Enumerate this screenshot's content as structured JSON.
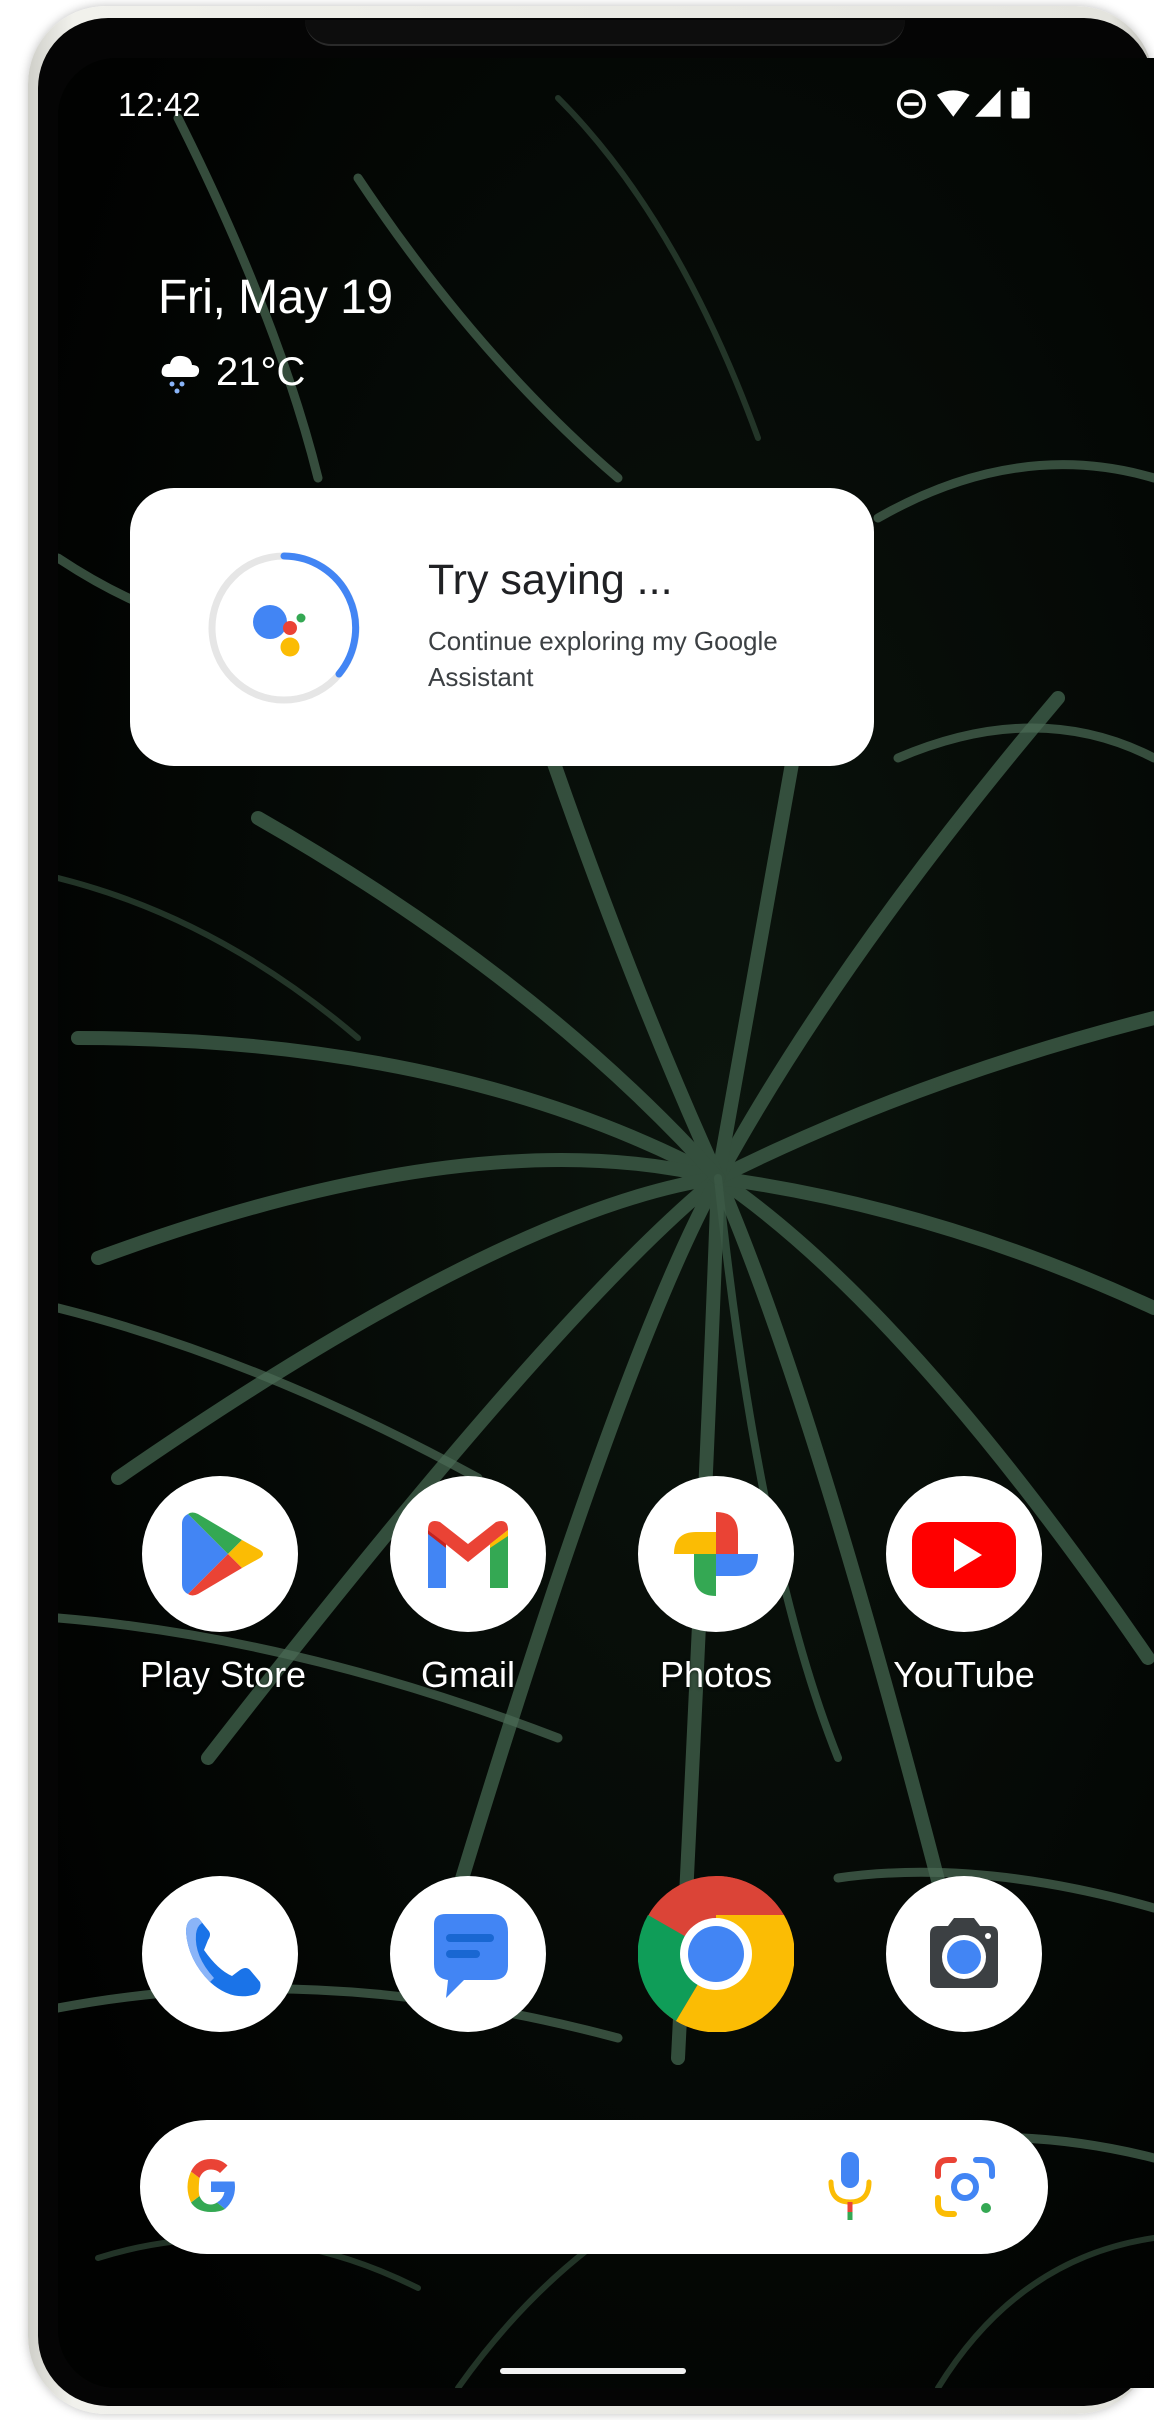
{
  "status_bar": {
    "time": "12:42",
    "icons": [
      "do-not-disturb-icon",
      "wifi-icon",
      "cellular-signal-icon",
      "battery-icon"
    ]
  },
  "at_a_glance": {
    "date": "Fri, May 19",
    "weather_icon": "rain-cloud-icon",
    "temperature": "21°C"
  },
  "assistant_card": {
    "title": "Try saying ...",
    "subtitle": "Continue exploring my Google Assistant",
    "icon": "google-assistant-icon",
    "progress": 0.35
  },
  "home_apps": [
    {
      "label": "Play Store",
      "icon": "play-store-icon"
    },
    {
      "label": "Gmail",
      "icon": "gmail-icon"
    },
    {
      "label": "Photos",
      "icon": "photos-icon"
    },
    {
      "label": "YouTube",
      "icon": "youtube-icon"
    }
  ],
  "dock_apps": [
    {
      "icon": "phone-icon"
    },
    {
      "icon": "messages-icon"
    },
    {
      "icon": "chrome-icon"
    },
    {
      "icon": "camera-icon"
    }
  ],
  "search_bar": {
    "icons": [
      "google-g-icon",
      "microphone-icon",
      "google-lens-icon"
    ]
  },
  "colors": {
    "google_blue": "#4285F4",
    "google_red": "#EA4335",
    "google_yellow": "#FBBC04",
    "google_green": "#34A853",
    "youtube_red": "#FF0000"
  }
}
